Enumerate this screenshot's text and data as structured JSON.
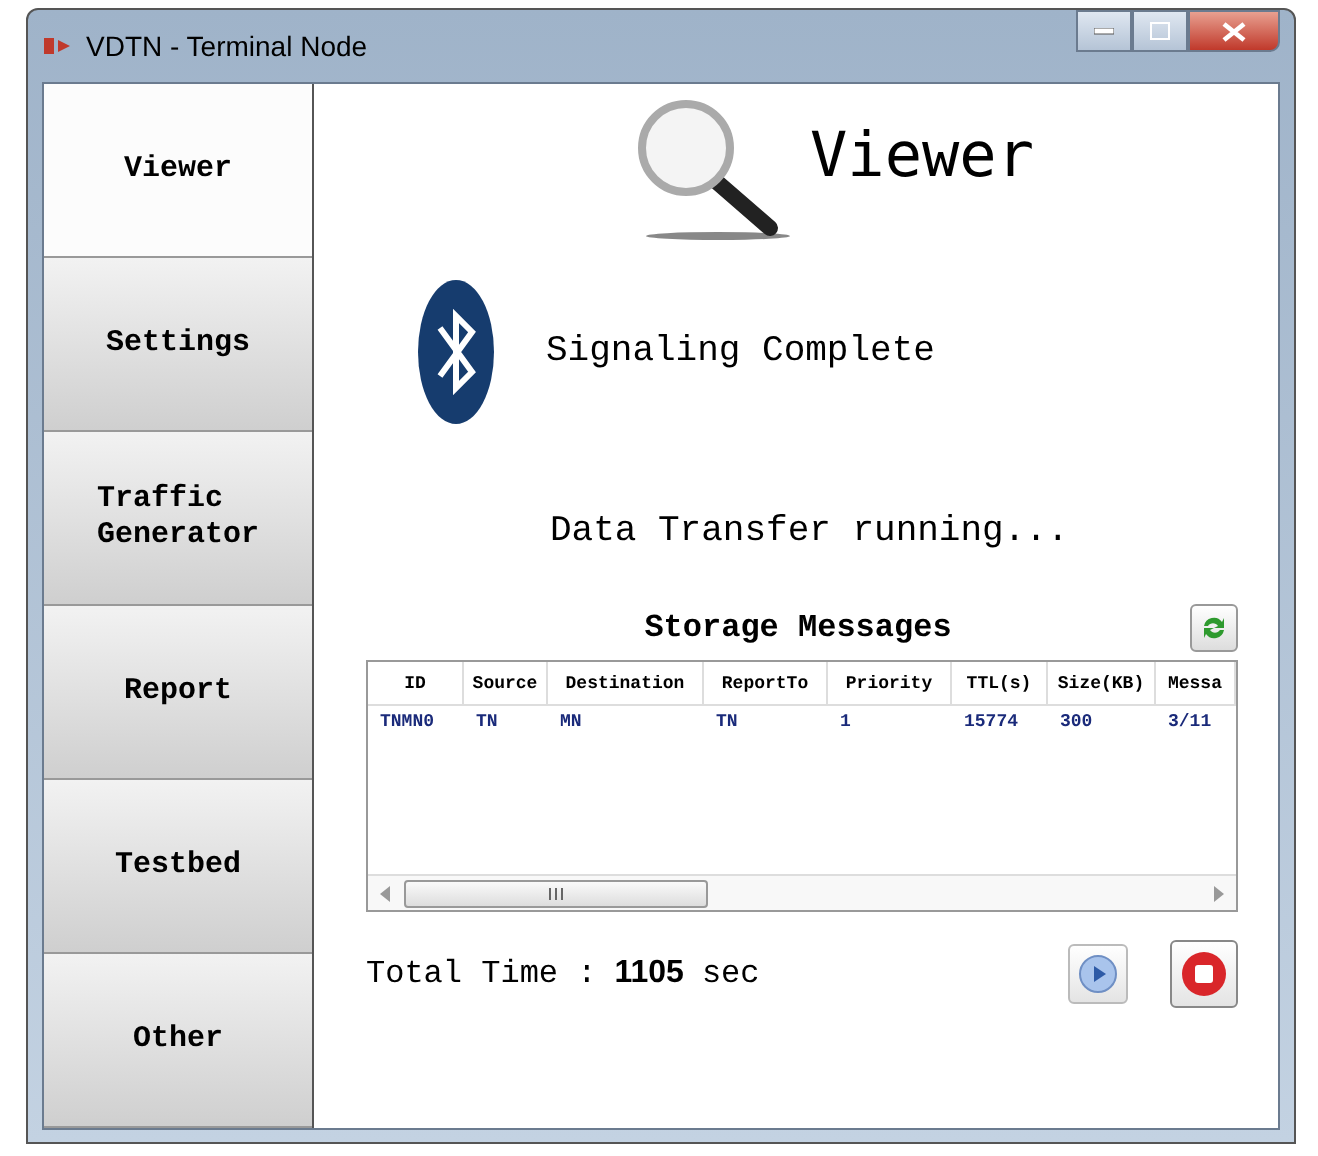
{
  "window": {
    "title": "VDTN - Terminal Node"
  },
  "sidebar": {
    "items": [
      {
        "label": "Viewer",
        "selected": true
      },
      {
        "label": "Settings",
        "selected": false
      },
      {
        "label": "Traffic\nGenerator",
        "selected": false
      },
      {
        "label": "Report",
        "selected": false
      },
      {
        "label": "Testbed",
        "selected": false
      },
      {
        "label": "Other",
        "selected": false
      }
    ]
  },
  "header": {
    "title": "Viewer"
  },
  "status": {
    "signaling": "Signaling Complete",
    "transfer": "Data Transfer running..."
  },
  "table": {
    "title": "Storage Messages",
    "columns": [
      "ID",
      "Source",
      "Destination",
      "ReportTo",
      "Priority",
      "TTL(s)",
      "Size(KB)",
      "Messa"
    ],
    "rows": [
      [
        "TNMN0",
        "TN",
        "MN",
        "TN",
        "1",
        "15774",
        "300",
        "3/11"
      ]
    ]
  },
  "footer": {
    "label": "Total Time :",
    "value": "1105",
    "unit": "sec"
  }
}
